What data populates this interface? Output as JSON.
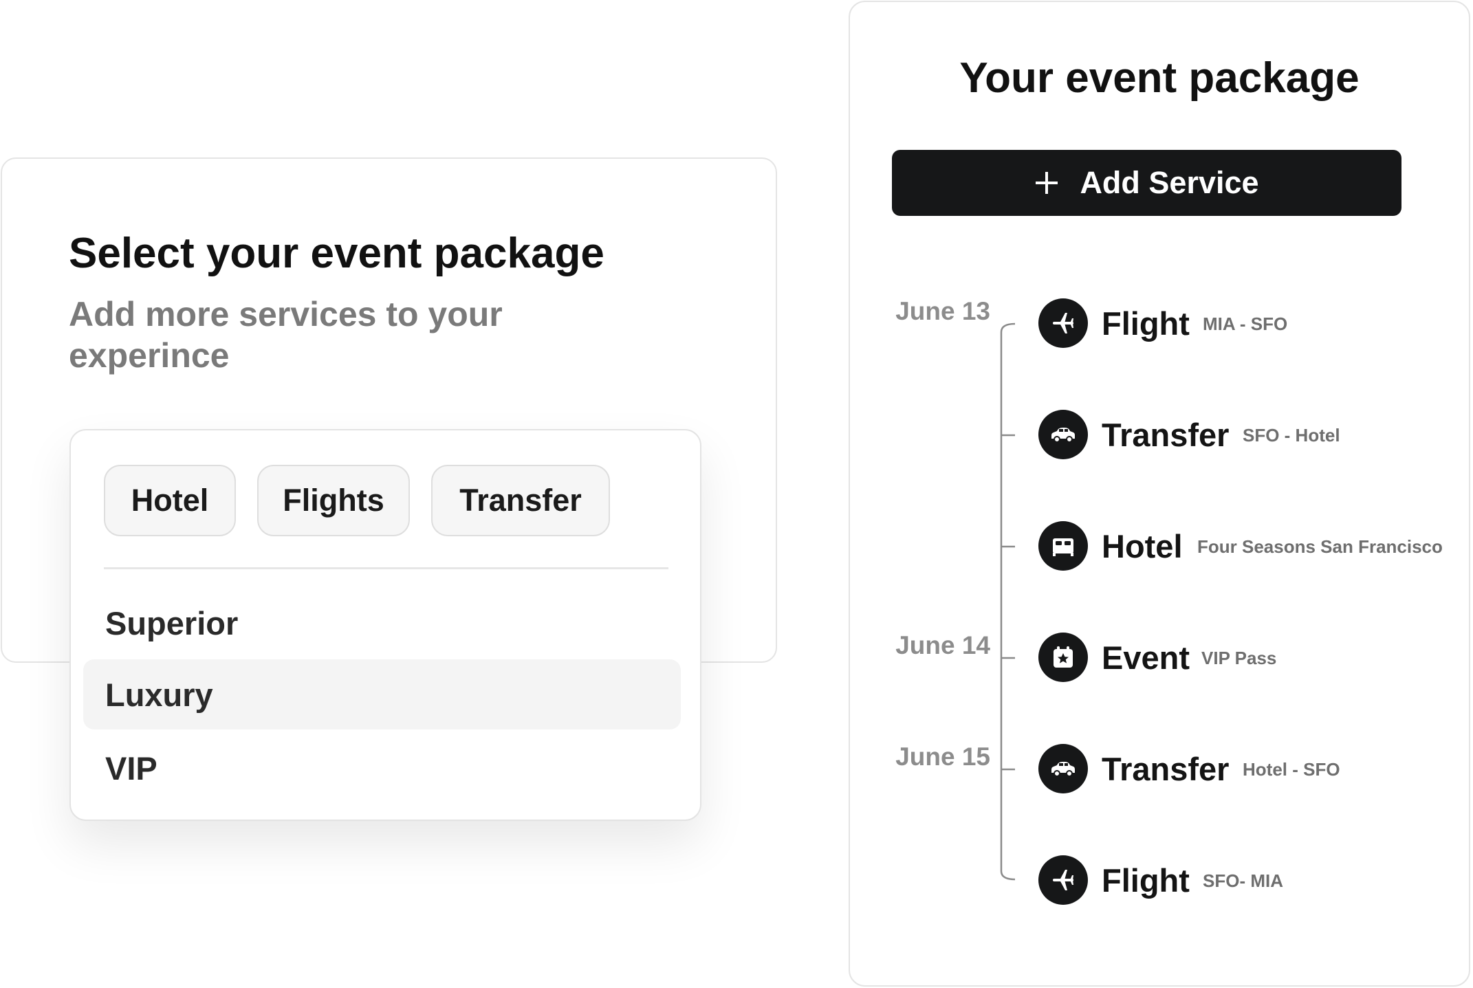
{
  "select_card": {
    "title": "Select your event package",
    "subtitle": "Add more services to your experince"
  },
  "dropdown": {
    "chips": [
      "Hotel",
      "Flights",
      "Transfer"
    ],
    "tiers": [
      "Superior",
      "Luxury",
      "VIP"
    ],
    "highlighted_tier": "Luxury"
  },
  "package_card": {
    "title": "Your event package",
    "add_button_label": "Add Service",
    "dates": [
      "June 13",
      "June 14",
      "June 15"
    ],
    "items": [
      {
        "icon": "airplane-icon",
        "label": "Flight",
        "detail": "MIA - SFO"
      },
      {
        "icon": "car-icon",
        "label": "Transfer",
        "detail": "SFO - Hotel"
      },
      {
        "icon": "bed-icon",
        "label": "Hotel",
        "detail": "Four Seasons San Francisco"
      },
      {
        "icon": "calendar-star-icon",
        "label": "Event",
        "detail": "VIP Pass"
      },
      {
        "icon": "car-icon",
        "label": "Transfer",
        "detail": "Hotel - SFO"
      },
      {
        "icon": "airplane-icon",
        "label": "Flight",
        "detail": "SFO- MIA"
      }
    ]
  },
  "colors": {
    "primary_dark": "#161718",
    "muted_text": "#8c8c8c",
    "border": "#e4e4e4",
    "chip_bg": "#f6f6f6",
    "highlight_bg": "#f4f4f4"
  }
}
